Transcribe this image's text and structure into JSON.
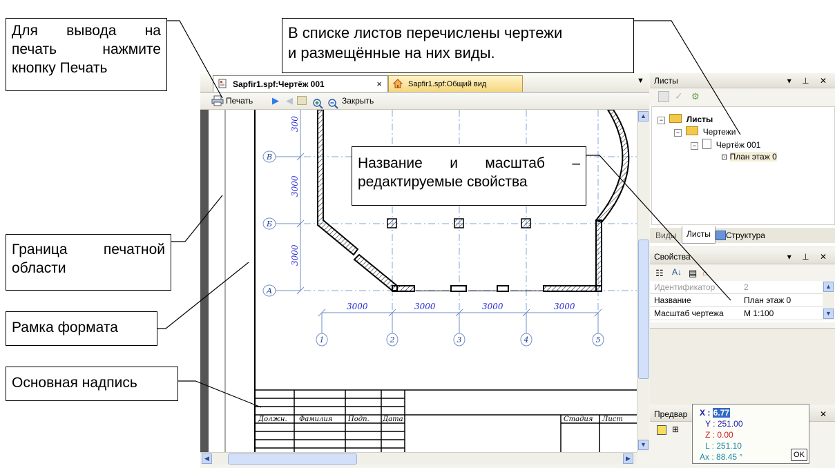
{
  "callouts": {
    "print": [
      "Для вывода на",
      "печать нажмите",
      "кнопку Печать"
    ],
    "sheets_list": [
      "В списке листов перечислены чертежи",
      "и размещённые на них виды."
    ],
    "name_scale": [
      "Название и масштаб –",
      "редактируемые свойства"
    ],
    "print_border": [
      "Граница печатной",
      "области"
    ],
    "format_frame": "Рамка формата",
    "title_block": "Основная надпись"
  },
  "tabs": [
    {
      "label": "Sapfir1.spf:Чертёж 001",
      "close": "×"
    },
    {
      "label": "Sapfir1.spf:Общий вид"
    }
  ],
  "toolbar": {
    "print_label": "Печать",
    "close_label": "Закрыть"
  },
  "drawing": {
    "axis_rows": [
      "В",
      "Б",
      "А"
    ],
    "axis_cols": [
      "1",
      "2",
      "3",
      "4",
      "5"
    ],
    "dims_vertical": [
      "300",
      "3000",
      "3000"
    ],
    "dims_horizontal": [
      "3000",
      "3000",
      "3000",
      "3000"
    ],
    "title_block_headers": [
      "Должн.",
      "Фамилия",
      "Подп.",
      "Дата"
    ],
    "title_block_right": [
      "Стадия",
      "Лист"
    ]
  },
  "sheets_panel": {
    "title": "Листы",
    "tree": [
      {
        "label": "Листы",
        "bold": true
      },
      {
        "label": "Чертежи"
      },
      {
        "label": "Чертёж 001"
      },
      {
        "label": "План этаж 0"
      }
    ],
    "bottom_tabs": [
      "Виды",
      "Листы",
      "Структура"
    ]
  },
  "properties_panel": {
    "title": "Свойства",
    "rows": [
      {
        "key": "Идентификатор",
        "value": "2"
      },
      {
        "key": "Название",
        "value": "План этаж 0"
      },
      {
        "key": "Масштаб чертежа",
        "value": "М 1:100"
      }
    ]
  },
  "preview_panel": {
    "title": "Предвар"
  },
  "coordinates": {
    "x_label": "X :",
    "x_value": "6.77",
    "y_label": "Y :",
    "y_value": "251.00",
    "z_label": "Z :",
    "z_value": "0.00",
    "l_label": "L :",
    "l_value": "251.10",
    "ax_label": "Ax :",
    "ax_value": "88.45 °",
    "ok": "OK"
  },
  "colors": {
    "accent_blue": "#2b2bd6",
    "axis_blue": "#1f5fbf",
    "highlight": "#316ac5"
  }
}
